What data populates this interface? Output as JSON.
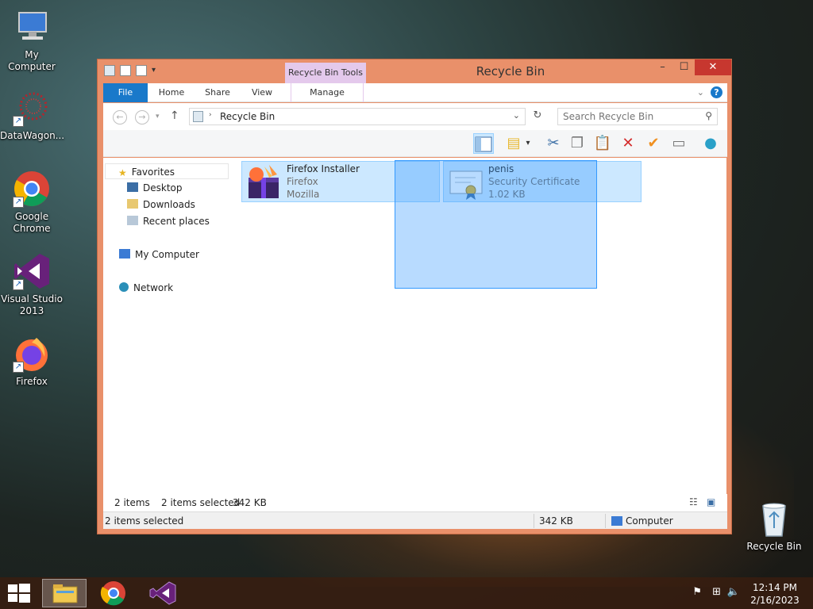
{
  "desktop": {
    "icons": [
      {
        "label": "My Computer"
      },
      {
        "label": "DataWagon..."
      },
      {
        "label": "Google Chrome"
      },
      {
        "label": "Visual Studio 2013"
      },
      {
        "label": "Firefox"
      },
      {
        "label": "Recycle Bin"
      }
    ]
  },
  "window": {
    "title": "Recycle Bin",
    "context_tab_header": "Recycle Bin Tools",
    "controls": {
      "minimize": "–",
      "maximize": "☐",
      "close": "✕"
    },
    "tabs": [
      "File",
      "Home",
      "Share",
      "View",
      "Manage"
    ],
    "help": "?",
    "address": {
      "path": "Recycle Bin",
      "search_placeholder": "Search Recycle Bin"
    },
    "navigation": {
      "favorites": "Favorites",
      "favorites_items": [
        "Desktop",
        "Downloads",
        "Recent places"
      ],
      "computer": "My Computer",
      "network": "Network"
    },
    "items": [
      {
        "name": "Firefox Installer",
        "type": "Firefox",
        "detail": "Mozilla"
      },
      {
        "name": "penis",
        "type": "Security Certificate",
        "detail": "1.02 KB"
      }
    ],
    "inner_status": {
      "count": "2 items",
      "selected": "2 items selected",
      "size": "342 KB"
    },
    "status_bar": {
      "selected": "2 items selected",
      "size": "342 KB",
      "location": "Computer"
    }
  },
  "taskbar": {
    "time": "12:14 PM",
    "date": "2/16/2023"
  },
  "colors": {
    "window_frame": "#e9906a",
    "ribbon_file": "#1979ca",
    "context_tab": "#e4c9ec",
    "selection": "#cce8ff",
    "close_button": "#c7372f"
  }
}
